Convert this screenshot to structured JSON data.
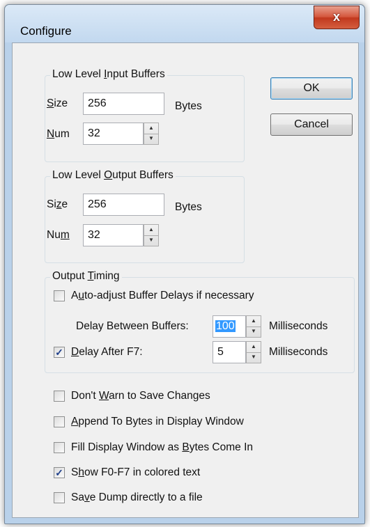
{
  "window": {
    "title": "Configure",
    "close_glyph": "x"
  },
  "input_buffers": {
    "legend_pre": "Low Level ",
    "legend_ul": "I",
    "legend_post": "nput Buffers",
    "size_label_ul": "S",
    "size_label_post": "ize",
    "size_value": "256",
    "size_unit": "Bytes",
    "num_label_ul": "N",
    "num_label_post": "um",
    "num_value": "32"
  },
  "output_buffers": {
    "legend_pre": "Low Level ",
    "legend_ul": "O",
    "legend_post": "utput Buffers",
    "size_label_pre": "Si",
    "size_label_ul": "z",
    "size_label_post": "e",
    "size_value": "256",
    "size_unit": "Bytes",
    "num_label_pre": "Nu",
    "num_label_ul": "m",
    "num_value": "32"
  },
  "buttons": {
    "ok": "OK",
    "cancel": "Cancel"
  },
  "output_timing": {
    "legend_pre": "Output ",
    "legend_ul": "T",
    "legend_post": "iming",
    "auto_adjust": {
      "pre": "A",
      "ul": "u",
      "post": "to-adjust Buffer Delays if necessary",
      "checked": false
    },
    "delay_between_label": "Delay Between Buffers:",
    "delay_between_value": "100",
    "delay_between_unit": "Milliseconds",
    "delay_after": {
      "ul": "D",
      "post": "elay After F7:",
      "checked": true
    },
    "delay_after_value": "5",
    "delay_after_unit": "Milliseconds"
  },
  "options": [
    {
      "pre": "Don't ",
      "ul": "W",
      "post": "arn to Save Changes",
      "checked": false
    },
    {
      "pre": "",
      "ul": "A",
      "post": "ppend To Bytes in Display Window",
      "checked": false
    },
    {
      "pre": "Fill Display Window as ",
      "ul": "B",
      "post": "ytes Come In",
      "checked": false
    },
    {
      "pre": "S",
      "ul": "h",
      "post": "ow F0-F7 in colored text",
      "checked": true
    },
    {
      "pre": "Sa",
      "ul": "v",
      "post": "e Dump directly to a file",
      "checked": false
    }
  ],
  "check_glyph": "✓",
  "spin_up_glyph": "▲",
  "spin_down_glyph": "▼"
}
